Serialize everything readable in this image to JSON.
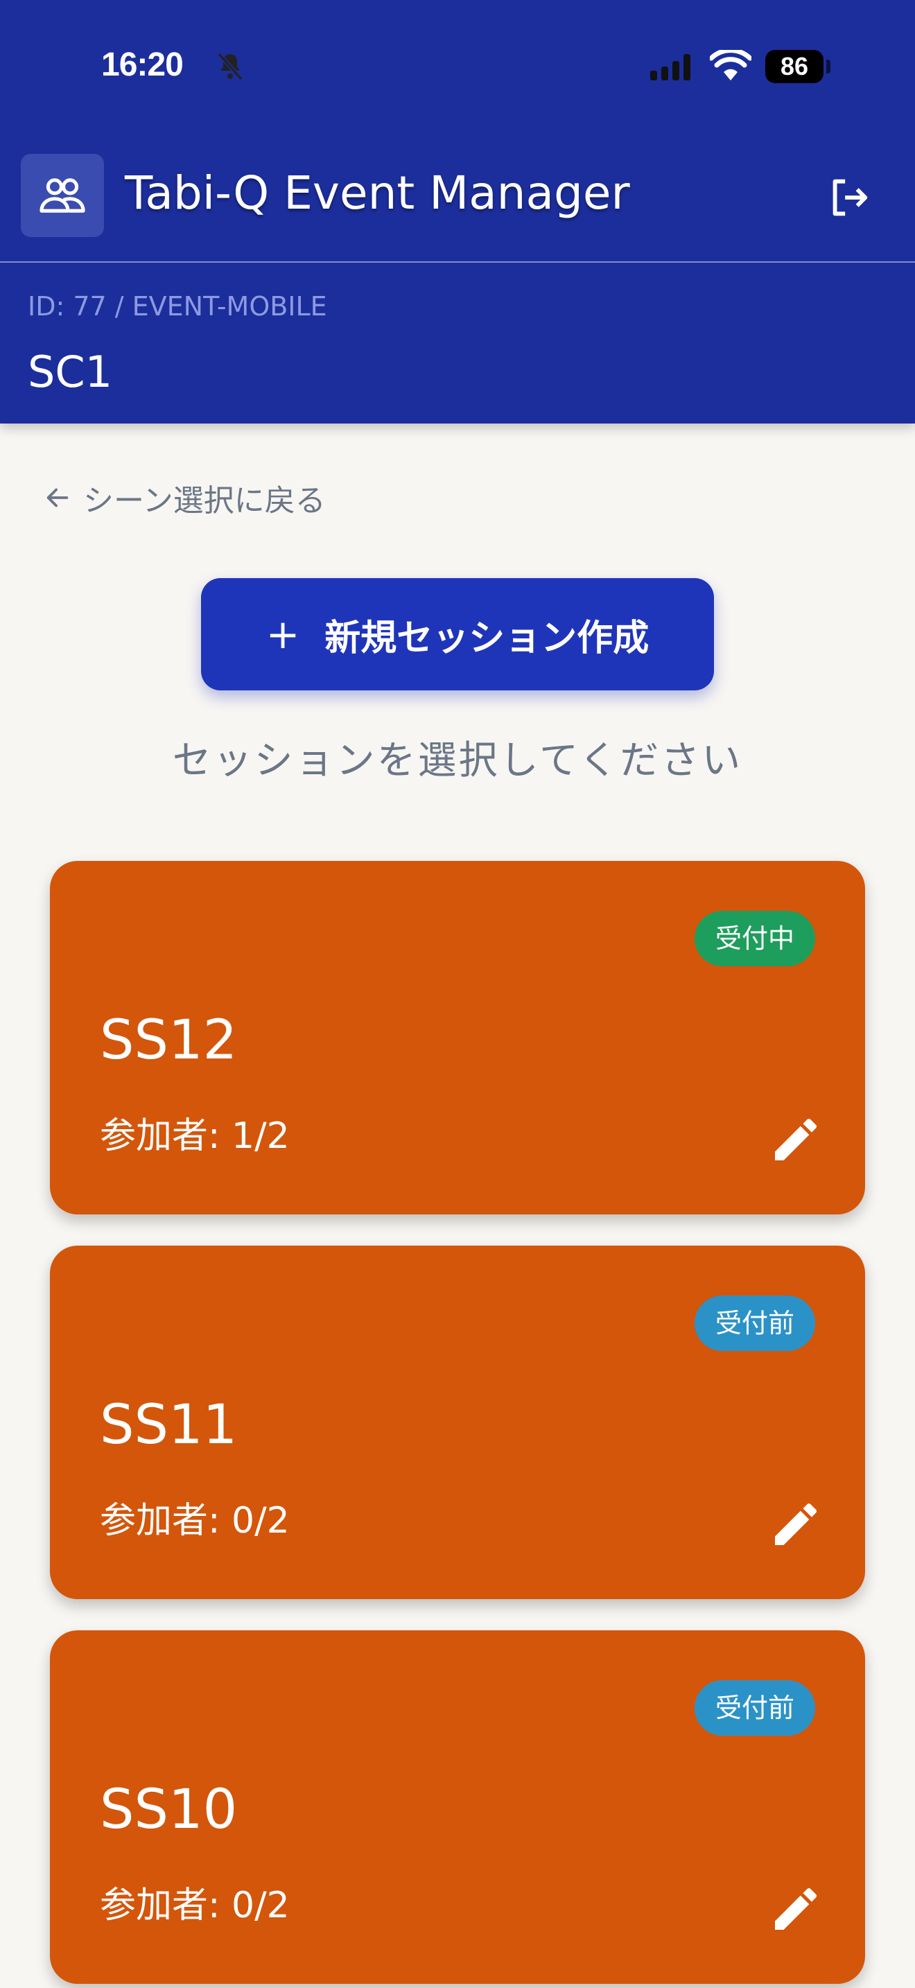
{
  "status_bar": {
    "time": "16:20",
    "battery": "86",
    "icons": [
      "bell-slash-icon",
      "signal-icon",
      "wifi-icon",
      "battery-icon"
    ]
  },
  "app_bar": {
    "title": "Tabi-Q Event Manager",
    "app_icon": "users-icon",
    "logout_icon": "logout-icon"
  },
  "event": {
    "id_label": "ID: 77 / EVENT-MOBILE",
    "scene_name": "SC1"
  },
  "nav": {
    "back_label": "シーン選択に戻る"
  },
  "actions": {
    "new_session_plus": "+",
    "new_session_label": "新規セッション作成"
  },
  "prompt": "セッションを選択してください",
  "colors": {
    "header_bg": "#1c2e9c",
    "primary_button": "#1f35b9",
    "card_bg": "#d3560b",
    "badge_open": "#1e9e5c",
    "badge_before": "#2b92c8",
    "page_bg": "#f8f6f3"
  },
  "sessions": [
    {
      "name": "SS12",
      "participants": "参加者: 1/2",
      "status": "受付中",
      "status_color": "#1e9e5c"
    },
    {
      "name": "SS11",
      "participants": "参加者: 0/2",
      "status": "受付前",
      "status_color": "#2b92c8"
    },
    {
      "name": "SS10",
      "participants": "参加者: 0/2",
      "status": "受付前",
      "status_color": "#2b92c8"
    }
  ]
}
